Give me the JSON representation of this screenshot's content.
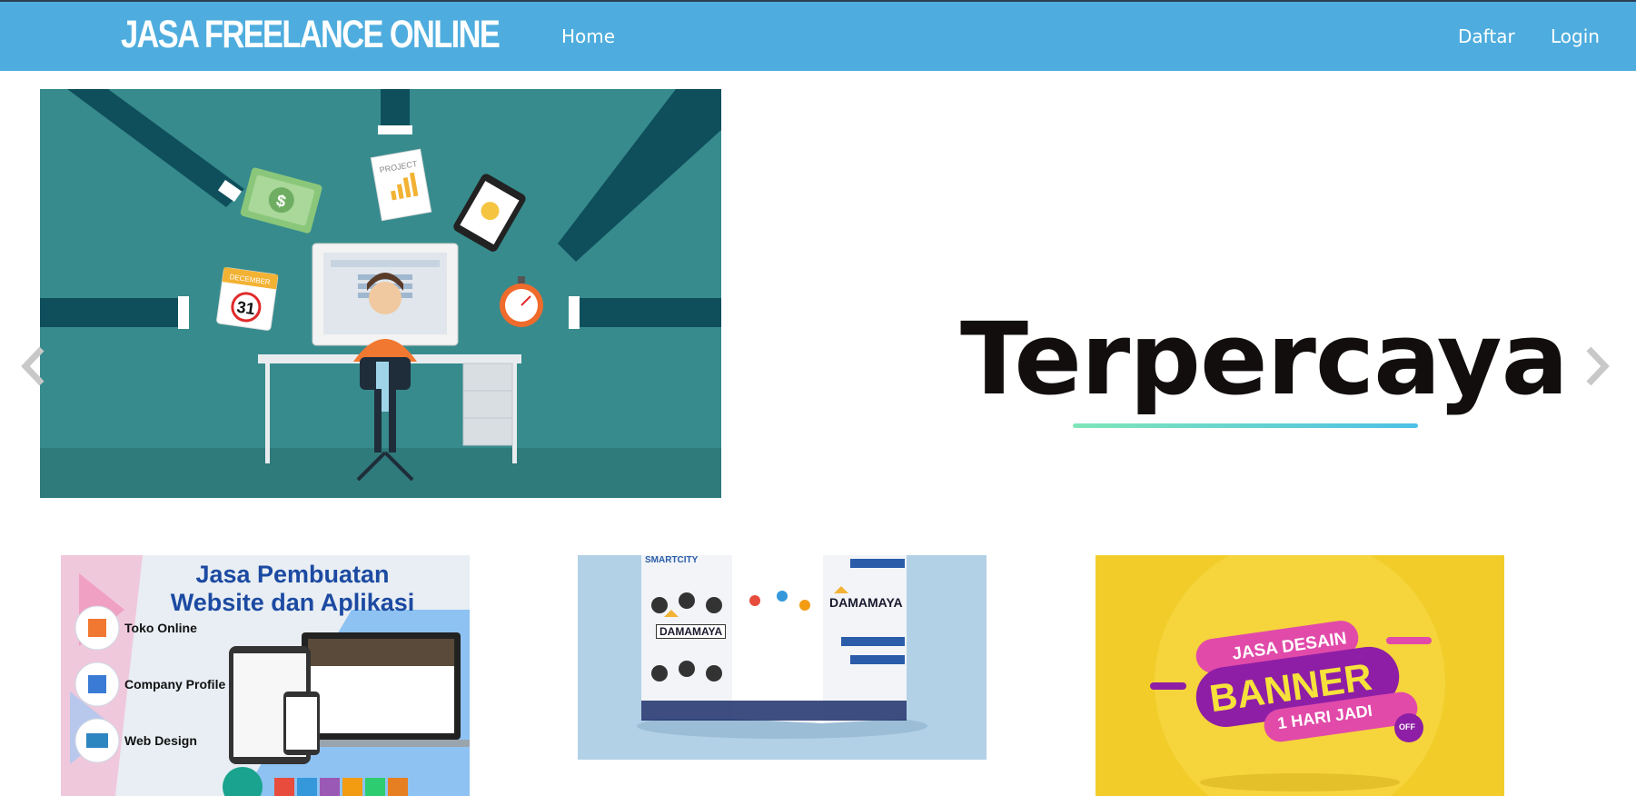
{
  "header": {
    "brand": "JASA FREELANCE ONLINE",
    "nav": {
      "home": "Home",
      "daftar": "Daftar",
      "login": "Login"
    },
    "bg_color": "#4eadde"
  },
  "carousel": {
    "headline": "Terpercaya",
    "image_text": {
      "project": "PROJECT",
      "calendar_month": "DECEMBER",
      "calendar_day": "31",
      "money_symbol": "$"
    },
    "prev_icon": "chevron-left-icon",
    "next_icon": "chevron-right-icon"
  },
  "cards": [
    {
      "title_line1": "Jasa Pembuatan",
      "title_line2": "Website dan Aplikasi",
      "items": [
        "Toko Online",
        "Company Profile",
        "Web Design"
      ]
    },
    {
      "texts": [
        "SMARTCITY",
        "DAMAMAYA",
        "DAMAMAYA"
      ]
    },
    {
      "line1": "JASA DESAIN",
      "line2": "BANNER",
      "line3": "1 HARI JADI",
      "badge": "OFF"
    }
  ]
}
